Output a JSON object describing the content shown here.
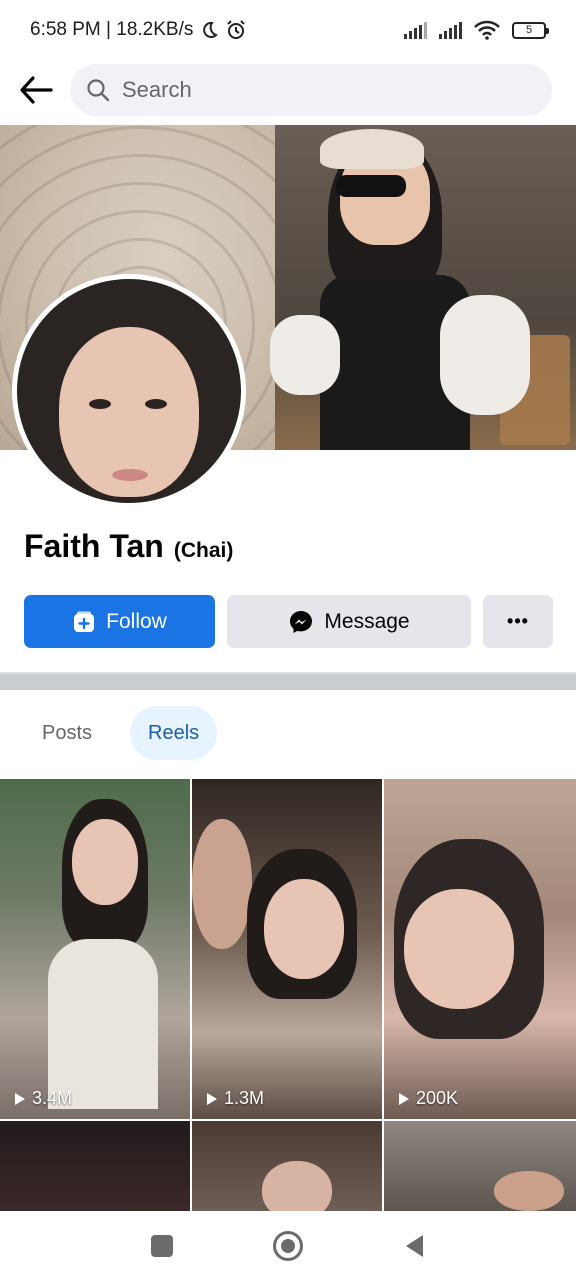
{
  "status_bar": {
    "time_speed": "6:58 PM | 18.2KB/s",
    "battery": "5"
  },
  "top_nav": {
    "search_placeholder": "Search"
  },
  "profile": {
    "name": "Faith Tan",
    "nickname": "(Chai)"
  },
  "actions": {
    "follow_label": "Follow",
    "message_label": "Message",
    "more_label": "•••"
  },
  "tabs": [
    {
      "label": "Posts",
      "active": false
    },
    {
      "label": "Reels",
      "active": true
    }
  ],
  "reels": [
    {
      "views": "3.4M"
    },
    {
      "views": "1.3M"
    },
    {
      "views": "200K"
    }
  ],
  "colors": {
    "accent": "#1b74e4",
    "tab_active_bg": "#e7f3ff",
    "tab_active_text": "#1b5fa8",
    "button_gray": "#e4e6eb"
  }
}
